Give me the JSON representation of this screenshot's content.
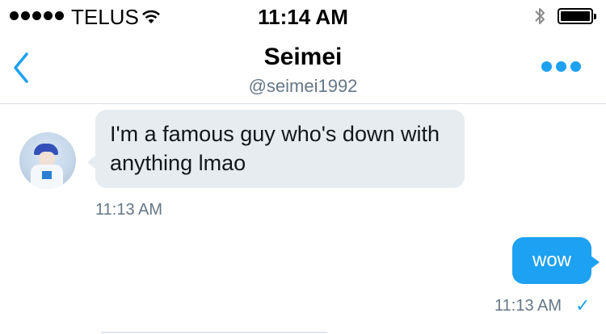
{
  "status_bar": {
    "carrier": "TELUS",
    "time": "11:14 AM",
    "signal_bars": 5,
    "battery_level": 1.0
  },
  "header": {
    "name": "Seimei",
    "handle": "@seimei1992",
    "accent_color": "#1da1f2"
  },
  "messages": [
    {
      "direction": "incoming",
      "text": "I'm a famous guy who's down with anything lmao",
      "time": "11:13 AM"
    },
    {
      "direction": "outgoing",
      "text": "wow",
      "time": "11:13 AM",
      "status_icon": "checkmark-icon"
    }
  ]
}
